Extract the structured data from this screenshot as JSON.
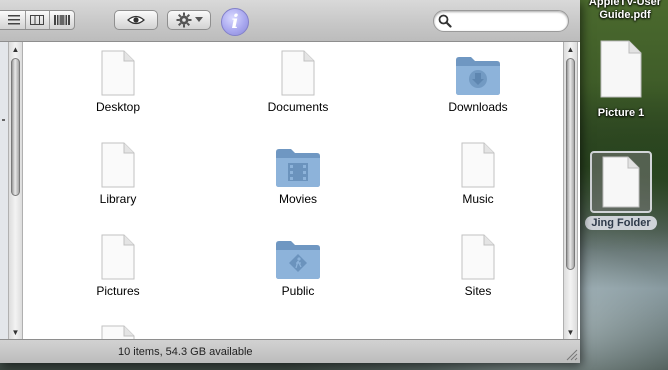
{
  "window": {
    "toolbar": {
      "view_buttons": [
        {
          "name": "list-view",
          "icon": "list-view-icon"
        },
        {
          "name": "column-view",
          "icon": "column-view-icon"
        },
        {
          "name": "coverflow-view",
          "icon": "coverflow-view-icon"
        }
      ],
      "quicklook_icon": "eye-icon",
      "action_icon": "gear-icon",
      "info_glyph": "i",
      "search": {
        "value": "",
        "placeholder": ""
      }
    },
    "items": [
      {
        "label": "Desktop",
        "kind": "document"
      },
      {
        "label": "Documents",
        "kind": "document"
      },
      {
        "label": "Downloads",
        "kind": "folder-downloads"
      },
      {
        "label": "Library",
        "kind": "document"
      },
      {
        "label": "Movies",
        "kind": "folder-movies"
      },
      {
        "label": "Music",
        "kind": "document"
      },
      {
        "label": "Pictures",
        "kind": "document"
      },
      {
        "label": "Public",
        "kind": "folder-public"
      },
      {
        "label": "Sites",
        "kind": "document"
      },
      {
        "label": "",
        "kind": "document"
      }
    ],
    "status": "10 items, 54.3 GB available"
  },
  "desktop": {
    "top_partial_label": [
      "AppleTV-User",
      "Guide.pdf"
    ],
    "icons": [
      {
        "label": "Picture 1",
        "selected": false
      },
      {
        "label": "Jing Folder",
        "selected": true
      }
    ]
  },
  "colors": {
    "folder_blue": "#7fa6cf",
    "toolbar_gray": "#c8c8c8",
    "info_purple": "#a9a8ef"
  }
}
